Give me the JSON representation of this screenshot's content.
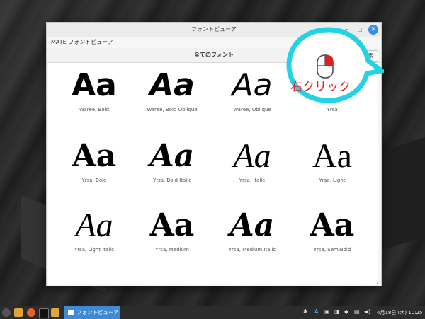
{
  "window": {
    "title": "フォントビューア",
    "app_title": "MATE フォントビューア",
    "heading": "全てのフォント",
    "search_label": "検索",
    "min_symbol": "–",
    "max_symbol": "□",
    "close_symbol": "✕"
  },
  "fonts": [
    {
      "sample": "Aa",
      "name": "Waree, Bold"
    },
    {
      "sample": "Aa",
      "name": "Waree, Bold Oblique"
    },
    {
      "sample": "Aa",
      "name": "Waree, Oblique"
    },
    {
      "sample": "Aa",
      "name": "Yrsa"
    },
    {
      "sample": "Aa",
      "name": "Yrsa, Bold"
    },
    {
      "sample": "Aa",
      "name": "Yrsa, Bold Italic"
    },
    {
      "sample": "Aa",
      "name": "Yrsa, Italic"
    },
    {
      "sample": "Aa",
      "name": "Yrsa, Light"
    },
    {
      "sample": "Aa",
      "name": "Yrsa, Light Italic"
    },
    {
      "sample": "Aa",
      "name": "Yrsa, Medium"
    },
    {
      "sample": "Aa",
      "name": "Yrsa, Medium Italic"
    },
    {
      "sample": "Aa",
      "name": "Yrsa, SemiBold"
    }
  ],
  "annotation": {
    "label": "右クリック",
    "color": "#e02020",
    "ring_color": "#22d3e6"
  },
  "taskbar": {
    "task_label": "フォントビューア",
    "clock": "4月18日 (木) 10:25",
    "tray_a": "A"
  }
}
